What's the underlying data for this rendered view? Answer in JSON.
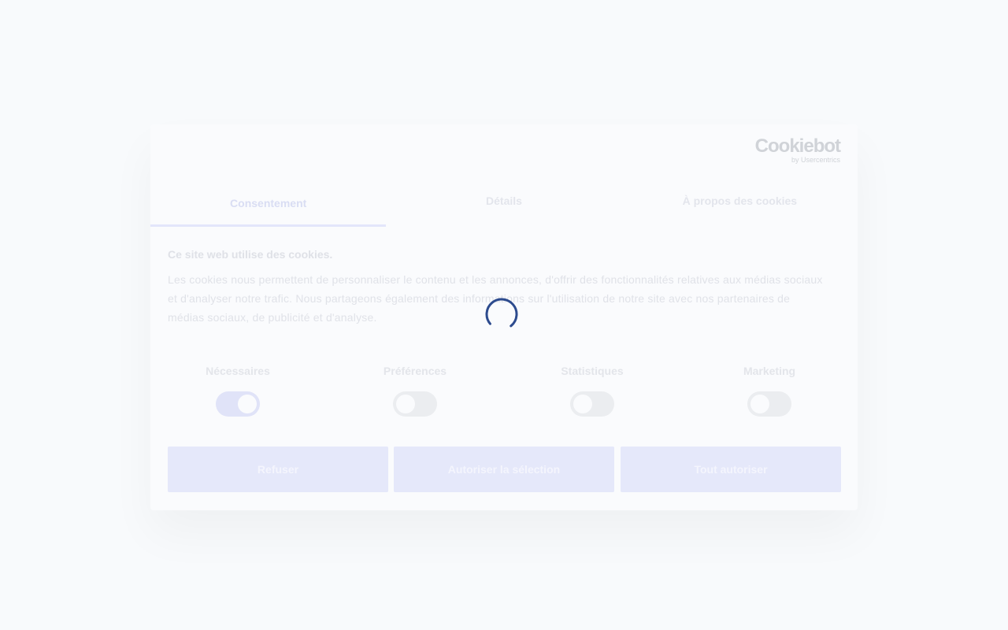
{
  "logo": {
    "main": "Cookiebot",
    "sub": "by Usercentrics"
  },
  "tabs": [
    {
      "label": "Consentement",
      "active": true
    },
    {
      "label": "Détails",
      "active": false
    },
    {
      "label": "À propos des cookies",
      "active": false
    }
  ],
  "heading": "Ce site web utilise des cookies.",
  "body": "Les cookies nous permettent de personnaliser le contenu et les annonces, d'offrir des fonctionnalités relatives aux médias sociaux et d'analyser notre trafic. Nous partageons également des informations sur l'utilisation de notre site avec nos partenaires de médias sociaux, de publicité et d'analyse.",
  "categories": [
    {
      "label": "Nécessaires",
      "enabled": true
    },
    {
      "label": "Préférences",
      "enabled": false
    },
    {
      "label": "Statistiques",
      "enabled": false
    },
    {
      "label": "Marketing",
      "enabled": false
    }
  ],
  "buttons": {
    "deny": "Refuser",
    "allow_selection": "Autoriser la sélection",
    "allow_all": "Tout autoriser"
  },
  "colors": {
    "spinner": "#2d4b8e",
    "accent_faded": "#e3e6fb"
  }
}
